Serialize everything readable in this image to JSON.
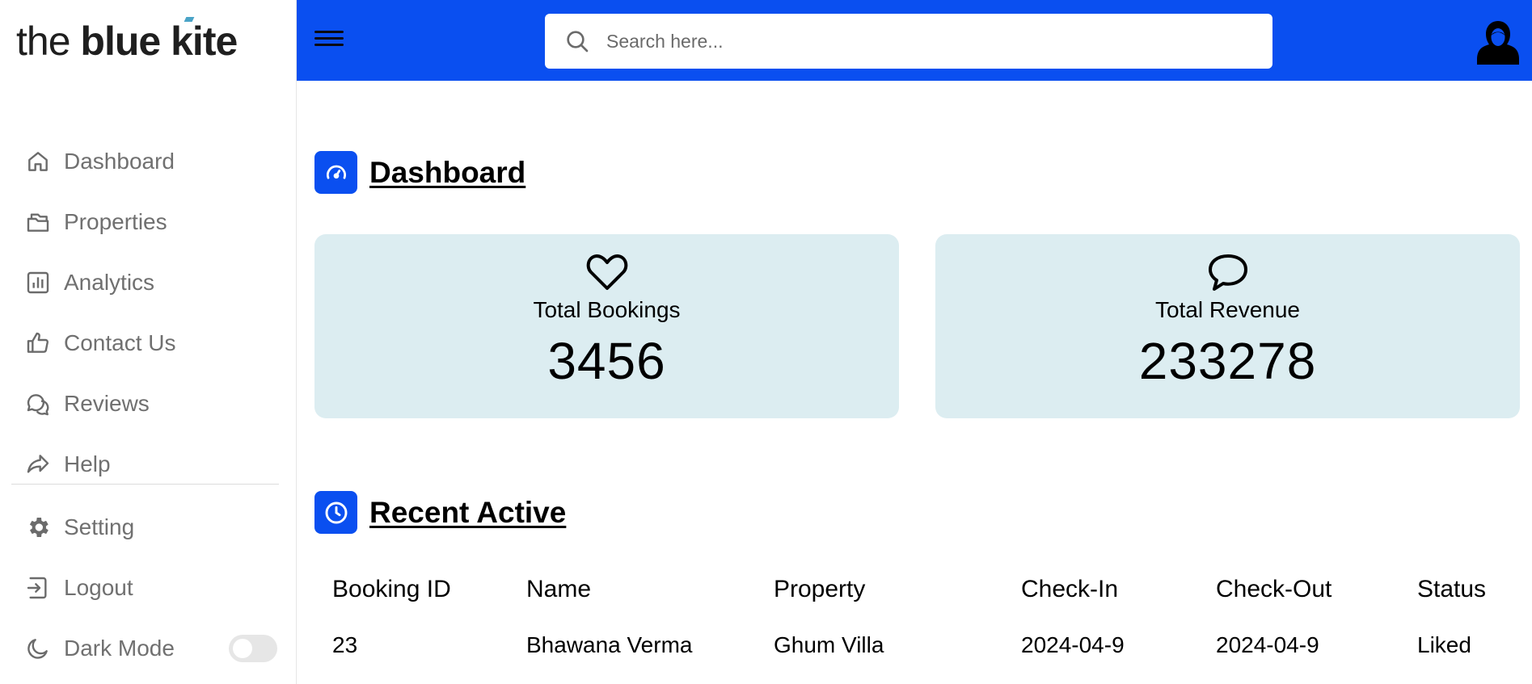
{
  "brand": {
    "logo_thin": "the",
    "logo_bold_1": "blue",
    "logo_bold_2": "kite"
  },
  "colors": {
    "primary": "#0a4ff0",
    "card_bg": "#dcedf1",
    "nav_text": "#707070"
  },
  "sidebar": {
    "items": [
      {
        "label": "Dashboard",
        "icon": "home-icon"
      },
      {
        "label": "Properties",
        "icon": "properties-icon"
      },
      {
        "label": "Analytics",
        "icon": "analytics-icon"
      },
      {
        "label": "Contact Us",
        "icon": "thumbs-up-icon"
      },
      {
        "label": "Reviews",
        "icon": "chat-bubbles-icon"
      },
      {
        "label": "Help",
        "icon": "share-arrow-icon"
      }
    ],
    "bottom": [
      {
        "label": "Setting",
        "icon": "gear-icon"
      },
      {
        "label": "Logout",
        "icon": "logout-icon"
      },
      {
        "label": "Dark Mode",
        "icon": "moon-icon"
      }
    ],
    "dark_mode_on": false
  },
  "topbar": {
    "search_placeholder": "Search here...",
    "search_value": ""
  },
  "dashboard": {
    "title": "Dashboard",
    "cards": [
      {
        "label": "Total Bookings",
        "value": "3456",
        "icon": "heart-icon"
      },
      {
        "label": "Total Revenue",
        "value": "233278",
        "icon": "speech-bubble-icon"
      }
    ]
  },
  "recent": {
    "title": "Recent Active",
    "columns": [
      "Booking ID",
      "Name",
      "Property",
      "Check-In",
      "Check-Out",
      "Status"
    ],
    "rows": [
      [
        "23",
        "Bhawana Verma",
        "Ghum Villa",
        "2024-04-9",
        "2024-04-9",
        "Liked"
      ]
    ]
  }
}
